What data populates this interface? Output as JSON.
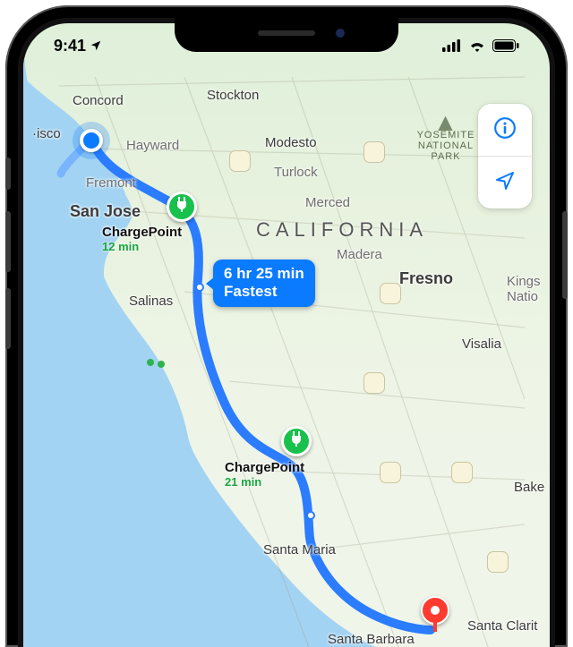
{
  "status": {
    "time": "9:41"
  },
  "region_label": "California",
  "park": {
    "line1": "Yosemite",
    "line2": "National",
    "line3": "Park"
  },
  "cities": {
    "concord": "Concord",
    "stockton": "Stockton",
    "sf": "·isco",
    "hayward": "Hayward",
    "modesto": "Modesto",
    "fremont": "Fremont",
    "turlock": "Turlock",
    "sanjose": "San Jose",
    "merced": "Merced",
    "madera": "Madera",
    "fresno": "Fresno",
    "kings": "Kings\nNatio",
    "salinas": "Salinas",
    "visalia": "Visalia",
    "santamaria": "Santa Maria",
    "bake": "Bake",
    "santabarbara": "Santa Barbara",
    "santaclarita": "Santa Clarit"
  },
  "charge_stops": [
    {
      "name": "ChargePoint",
      "duration": "12 min"
    },
    {
      "name": "ChargePoint",
      "duration": "21 min"
    }
  ],
  "route_callout": {
    "time": "6 hr 25 min",
    "tag": "Fastest"
  },
  "colors": {
    "route": "#2b7cff",
    "accent": "#0a7aff",
    "charge": "#18c14b",
    "dest": "#ff3b30"
  }
}
